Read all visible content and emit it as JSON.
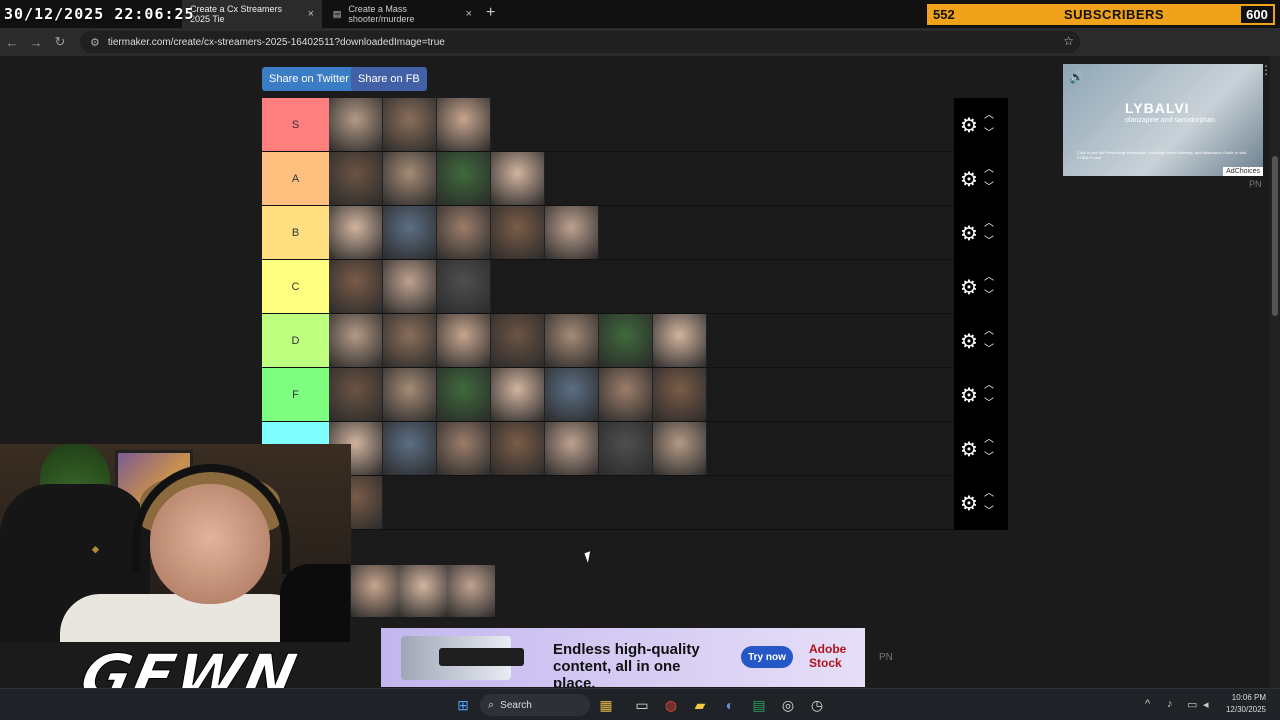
{
  "overlay": {
    "datetime": "30/12/2025 22:06:25",
    "subs_current": "552",
    "subs_label": "SUBSCRIBERS",
    "subs_goal": "600",
    "logo": "GEWN"
  },
  "browser": {
    "tabs": [
      {
        "title": "Create a Cx Streamers 2025 Tie",
        "favicon": "tiermaker-icon"
      },
      {
        "title": "Create a Mass shooter/murdere",
        "favicon": "tiermaker-icon"
      }
    ],
    "url": "tiermaker.com/create/cx-streamers-2025-16402511?downloadedImage=true"
  },
  "page": {
    "share_twitter": "Share on Twitter",
    "share_fb": "Share on FB",
    "tiers": [
      {
        "label": "S",
        "color": "#ff7f7f",
        "count": 3
      },
      {
        "label": "A",
        "color": "#ffbf7f",
        "count": 4
      },
      {
        "label": "B",
        "color": "#ffdf7f",
        "count": 5
      },
      {
        "label": "C",
        "color": "#ffff7f",
        "count": 3
      },
      {
        "label": "D",
        "color": "#bfff7f",
        "count": 7
      },
      {
        "label": "F",
        "color": "#7fff7f",
        "count": 7
      },
      {
        "label": "",
        "color": "#7fffff",
        "count": 7
      },
      {
        "label": "",
        "color": "#7fbfff",
        "count": 1
      }
    ],
    "pool_count": 3
  },
  "ads": {
    "right": {
      "brand": "LYBALVI",
      "sub": "olanzapine and samidorphan",
      "fine": "Click to see full Prescribing Information, including Boxed Warning, and Medication Guide or visit LYBALVI.com",
      "adchoices": "AdChoices",
      "pn": "PN"
    },
    "bottom": {
      "headline": "Endless high-quality content, all in one place.",
      "cta": "Try now",
      "brand": "Adobe Stock",
      "pn": "PN"
    }
  },
  "taskbar": {
    "search": "Search",
    "time": "10:06 PM",
    "date": "12/30/2025"
  }
}
